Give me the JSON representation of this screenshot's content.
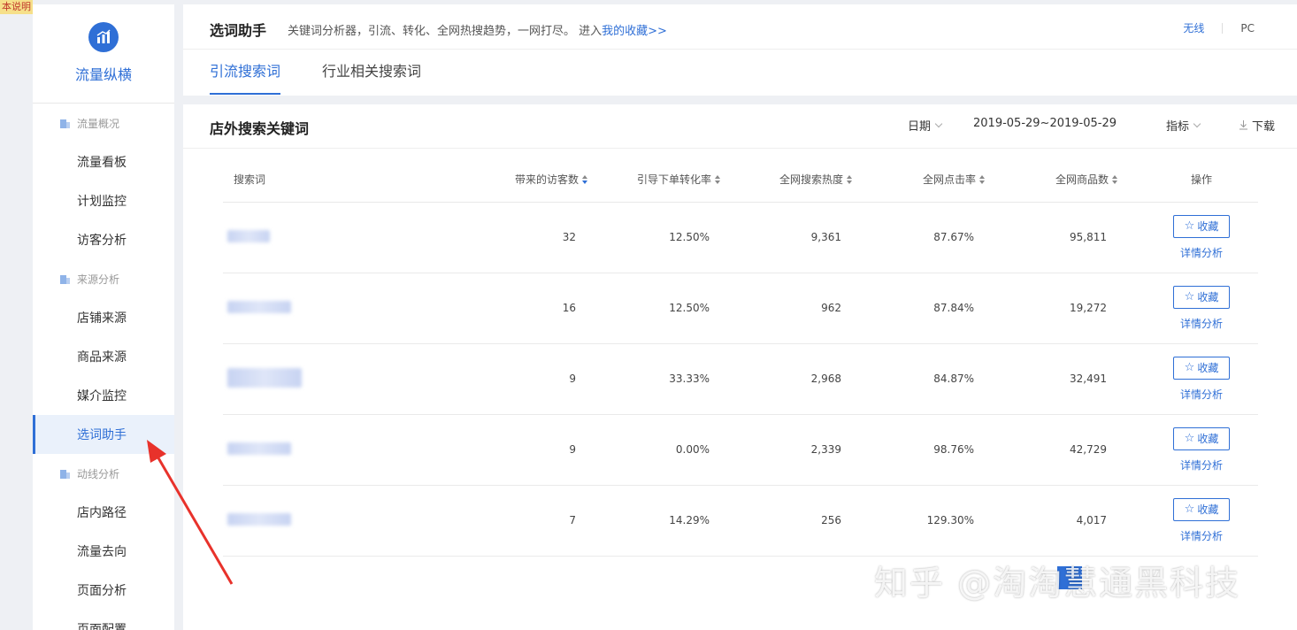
{
  "corner_tag": "本说明",
  "sidebar": {
    "brand": "流量纵横",
    "groups": [
      {
        "label": "流量概况",
        "items": [
          "流量看板",
          "计划监控",
          "访客分析"
        ]
      },
      {
        "label": "来源分析",
        "items": [
          "店铺来源",
          "商品来源",
          "媒介监控",
          "选词助手"
        ]
      },
      {
        "label": "动线分析",
        "items": [
          "店内路径",
          "流量去向",
          "页面分析",
          "页面配置"
        ]
      }
    ],
    "active_item": "选词助手"
  },
  "header": {
    "title": "选词助手",
    "desc": "关键词分析器，引流、转化、全网热搜趋势，一网打尽。 进入",
    "link": "我的收藏>>",
    "switch_wireless": "无线",
    "switch_pc": "PC",
    "tabs": [
      "引流搜索词",
      "行业相关搜索词"
    ]
  },
  "main": {
    "title": "店外搜索关键词",
    "filter_date": "日期",
    "date_range": "2019-05-29~2019-05-29",
    "filter_metric": "指标",
    "download": "下载",
    "columns": [
      "搜索词",
      "带来的访客数",
      "引导下单转化率",
      "全网搜索热度",
      "全网点击率",
      "全网商品数",
      "操作"
    ],
    "rows": [
      {
        "visitors": "32",
        "conv": "12.50%",
        "heat": "9,361",
        "ctr": "87.67%",
        "items": "95,811"
      },
      {
        "visitors": "16",
        "conv": "12.50%",
        "heat": "962",
        "ctr": "87.84%",
        "items": "19,272"
      },
      {
        "visitors": "9",
        "conv": "33.33%",
        "heat": "2,968",
        "ctr": "84.87%",
        "items": "32,491"
      },
      {
        "visitors": "9",
        "conv": "0.00%",
        "heat": "2,339",
        "ctr": "98.76%",
        "items": "42,729"
      },
      {
        "visitors": "7",
        "conv": "14.29%",
        "heat": "256",
        "ctr": "129.30%",
        "items": "4,017"
      }
    ],
    "fav_label": "收藏",
    "detail_label": "详情分析"
  },
  "watermark": "知乎 @淘淘慧通黑科技",
  "colors": {
    "accent": "#2f6fd6",
    "arrow": "#e8322b"
  }
}
